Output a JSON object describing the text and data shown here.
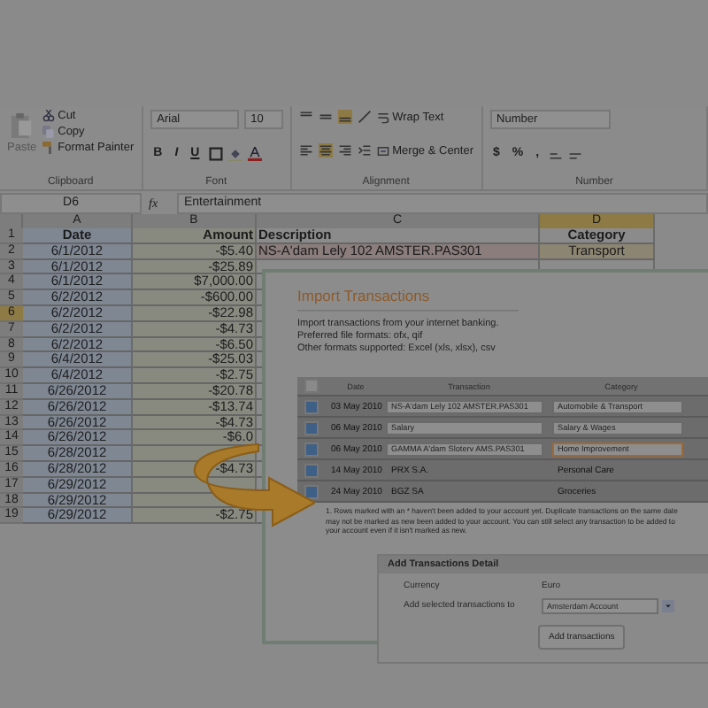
{
  "ribbon": {
    "clipboard": {
      "paste": "Paste",
      "cut": "Cut",
      "copy": "Copy",
      "format_painter": "Format Painter",
      "label": "Clipboard"
    },
    "font": {
      "family": "Arial",
      "size": "10",
      "style_buttons": [
        "B",
        "I",
        "U"
      ],
      "label": "Font"
    },
    "alignment": {
      "wrap_text": "Wrap Text",
      "merge_center": "Merge & Center",
      "label": "Alignment"
    },
    "number": {
      "format": "Number",
      "buttons": [
        "$",
        "%",
        ","
      ],
      "label": "Number"
    }
  },
  "formula_bar": {
    "cell": "D6",
    "fx": "fx",
    "value": "Entertainment"
  },
  "sheet": {
    "columns": [
      {
        "label": "A",
        "selected": false
      },
      {
        "label": "B",
        "selected": false
      },
      {
        "label": "C",
        "selected": false
      },
      {
        "label": "D",
        "selected": true
      }
    ],
    "header_row_number": "1",
    "headers": [
      "Date",
      "Amount",
      "Description",
      "Category"
    ],
    "rows": [
      {
        "number": "2",
        "selected": false,
        "date": "6/1/2012",
        "amount": "-$5.40",
        "description": "NS-A'dam Lely 102 AMSTER.PAS301",
        "category": "Transport"
      },
      {
        "number": "3",
        "selected": false,
        "date": "6/1/2012",
        "amount": "-$25.89"
      },
      {
        "number": "4",
        "selected": false,
        "date": "6/1/2012",
        "amount": "$7,000.00"
      },
      {
        "number": "5",
        "selected": false,
        "date": "6/2/2012",
        "amount": "-$600.00"
      },
      {
        "number": "6",
        "selected": true,
        "date": "6/2/2012",
        "amount": "-$22.98"
      },
      {
        "number": "7",
        "selected": false,
        "date": "6/2/2012",
        "amount": "-$4.73"
      },
      {
        "number": "8",
        "selected": false,
        "date": "6/2/2012",
        "amount": "-$6.50"
      },
      {
        "number": "9",
        "selected": false,
        "date": "6/4/2012",
        "amount": "-$25.03"
      },
      {
        "number": "10",
        "selected": false,
        "date": "6/4/2012",
        "amount": "-$2.75"
      },
      {
        "number": "11",
        "selected": false,
        "date": "6/26/2012",
        "amount": "-$20.78"
      },
      {
        "number": "12",
        "selected": false,
        "date": "6/26/2012",
        "amount": "-$13.74"
      },
      {
        "number": "13",
        "selected": false,
        "date": "6/26/2012",
        "amount": "-$4.73"
      },
      {
        "number": "14",
        "selected": false,
        "date": "6/26/2012",
        "amount": "-$6.0"
      },
      {
        "number": "15",
        "selected": false,
        "date": "6/28/2012"
      },
      {
        "number": "16",
        "selected": false,
        "date": "6/28/2012",
        "amount": "-$4.73"
      },
      {
        "number": "17",
        "selected": false,
        "date": "6/29/2012"
      },
      {
        "number": "18",
        "selected": false,
        "date": "6/29/2012"
      },
      {
        "number": "19",
        "selected": false,
        "date": "6/29/2012",
        "amount": "-$2.75"
      }
    ]
  },
  "dialog": {
    "title": "Import Transactions",
    "intro": [
      "Import transactions from your internet banking.",
      "Preferred file formats: ofx, qif",
      "Other formats supported: Excel (xls, xlsx), csv"
    ],
    "table": {
      "select_all_checked": false,
      "columns": [
        "Date",
        "Transaction",
        "Category"
      ],
      "rows": [
        {
          "checked": true,
          "kind": "editable",
          "highlighted": false,
          "date": "03 May 2010",
          "transaction": "NS-A'dam Lely 102 AMSTER.PAS301",
          "category": "Automobile & Transport"
        },
        {
          "checked": true,
          "kind": "editable",
          "highlighted": false,
          "date": "06 May 2010",
          "transaction": "Salary",
          "category": "Salary & Wages"
        },
        {
          "checked": true,
          "kind": "editable",
          "highlighted": true,
          "date": "06 May 2010",
          "transaction": "GAMMA A'dam Sloterv AMS.PAS301",
          "category": "Home Improvement"
        },
        {
          "checked": true,
          "kind": "text",
          "highlighted": false,
          "date": "14 May 2010",
          "transaction": "PRX S.A.",
          "category": "Personal Care"
        },
        {
          "checked": true,
          "kind": "text",
          "highlighted": false,
          "date": "24 May 2010",
          "transaction": "BGZ SA",
          "category": "Groceries"
        }
      ]
    },
    "note": "1. Rows marked with an * haven't been added to your account yet. Duplicate transactions on the same date may not be marked as new been added to your account. You can still select any transaction to be added to your account even if it isn't marked as new.",
    "detail": {
      "title": "Add Transactions Detail",
      "currency_label": "Currency",
      "currency": "Euro",
      "account_label": "Add selected transactions to",
      "account": "Amsterdam Account",
      "button": "Add transactions"
    }
  }
}
